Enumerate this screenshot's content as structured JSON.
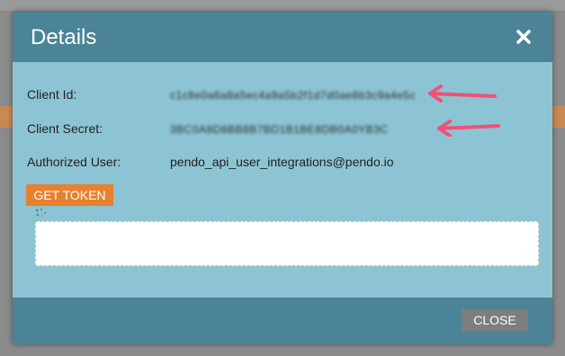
{
  "dialog": {
    "title": "Details",
    "close_icon": "close-icon"
  },
  "fields": {
    "client_id": {
      "label": "Client Id:",
      "value": "c1c8e0a6a8a5ec4a9a5b2f1d7d0ae8b3c9a4e5c"
    },
    "client_secret": {
      "label": "Client Secret:",
      "value": "3BC0A8D8BB8B7BD1B1BE8DB0A0YB3C"
    },
    "authorized_user": {
      "label": "Authorized User:",
      "value": "pendo_api_user_integrations@pendo.io"
    }
  },
  "actions": {
    "get_token_label": "GET TOKEN",
    "close_label": "CLOSE"
  },
  "token_output": {
    "value": ""
  },
  "colors": {
    "header": "#4b8497",
    "body": "#8cc4d4",
    "accent_button": "#e7802f",
    "close_button": "#7e7e7e",
    "arrow": "#f0507a"
  }
}
